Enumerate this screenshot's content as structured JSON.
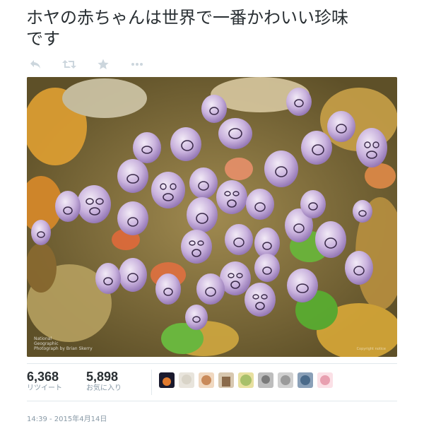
{
  "tweet": {
    "text_line1": "ホヤの赤ちゃんは世界で一番かわいい珍味",
    "text_line2": "です"
  },
  "actions": [
    {
      "icon": "reply-icon"
    },
    {
      "icon": "retweet-icon"
    },
    {
      "icon": "favorite-star-icon"
    },
    {
      "icon": "more-dots-icon"
    }
  ],
  "photo": {
    "subject": "purple baby sea squirts with face-like openings",
    "credit_line1": "National",
    "credit_line2": "Geographic",
    "credit_line3": "Photograph by Brian Skerry",
    "copyright": "Copyright notice"
  },
  "stats": {
    "retweets_count": "6,368",
    "retweets_label": "リツイート",
    "favorites_count": "5,898",
    "favorites_label": "お気に入り"
  },
  "avatars": [
    {
      "color": "#e07a2e"
    },
    {
      "color": "#d9d4c8"
    },
    {
      "color": "#c98a5a"
    },
    {
      "color": "#8a6a4a"
    },
    {
      "color": "#a8c06a"
    },
    {
      "color": "#7a7a7a"
    },
    {
      "color": "#9a9a9a"
    },
    {
      "color": "#4a6a8a"
    },
    {
      "color": "#e8a0b0"
    }
  ],
  "timestamp": "14:39 - 2015年4月14日",
  "colors": {
    "text": "#292f33",
    "muted": "#8899a6",
    "action_icon": "#ccd6dd",
    "border": "#e1e8ed"
  }
}
